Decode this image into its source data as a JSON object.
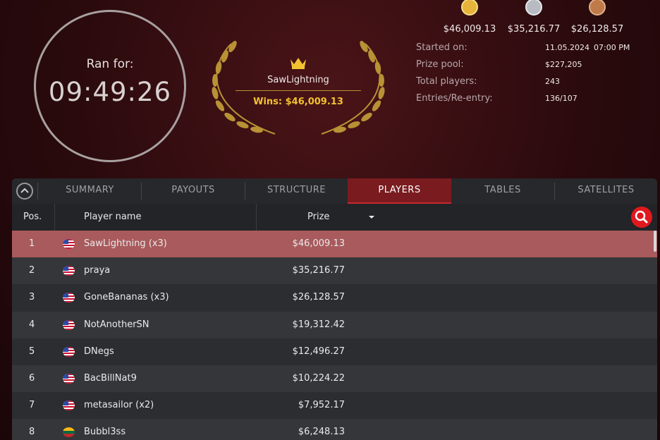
{
  "clock": {
    "label": "Ran for:",
    "time": "09:49:26"
  },
  "winner": {
    "name": "SawLightning",
    "wins": "Wins: $46,009.13",
    "gold": "#f2c230"
  },
  "medals": [
    {
      "amount": "$46,009.13",
      "type": "gold"
    },
    {
      "amount": "$35,216.77",
      "type": "silver"
    },
    {
      "amount": "$26,128.57",
      "type": "bronze"
    }
  ],
  "info": {
    "started_label": "Started on:",
    "started_date": "11.05.2024",
    "started_time": "07:00 PM",
    "prize_pool_label": "Prize pool:",
    "prize_pool": "$227,205",
    "total_players_label": "Total players:",
    "total_players": "243",
    "entries_label": "Entries/Re-entry:",
    "entries": "136/107"
  },
  "tabs": {
    "summary": "SUMMARY",
    "payouts": "PAYOUTS",
    "structure": "STRUCTURE",
    "players": "PLAYERS",
    "tables": "TABLES",
    "satellites": "SATELLITES",
    "active": "players",
    "accent": "#7a1c1f"
  },
  "table": {
    "headers": {
      "pos": "Pos.",
      "player": "Player name",
      "prize": "Prize"
    },
    "rows": [
      {
        "pos": "1",
        "name": "SawLightning (x3)",
        "prize": "$46,009.13",
        "flag": "us"
      },
      {
        "pos": "2",
        "name": "praya",
        "prize": "$35,216.77",
        "flag": "us"
      },
      {
        "pos": "3",
        "name": "GoneBananas (x3)",
        "prize": "$26,128.57",
        "flag": "us"
      },
      {
        "pos": "4",
        "name": "NotAnotherSN",
        "prize": "$19,312.42",
        "flag": "us"
      },
      {
        "pos": "5",
        "name": "DNegs",
        "prize": "$12,496.27",
        "flag": "us"
      },
      {
        "pos": "6",
        "name": "BacBillNat9",
        "prize": "$10,224.22",
        "flag": "us"
      },
      {
        "pos": "7",
        "name": "metasailor (x2)",
        "prize": "$7,952.17",
        "flag": "us"
      },
      {
        "pos": "8",
        "name": "Bubbl3ss",
        "prize": "$6,248.13",
        "flag": "lt"
      }
    ]
  }
}
